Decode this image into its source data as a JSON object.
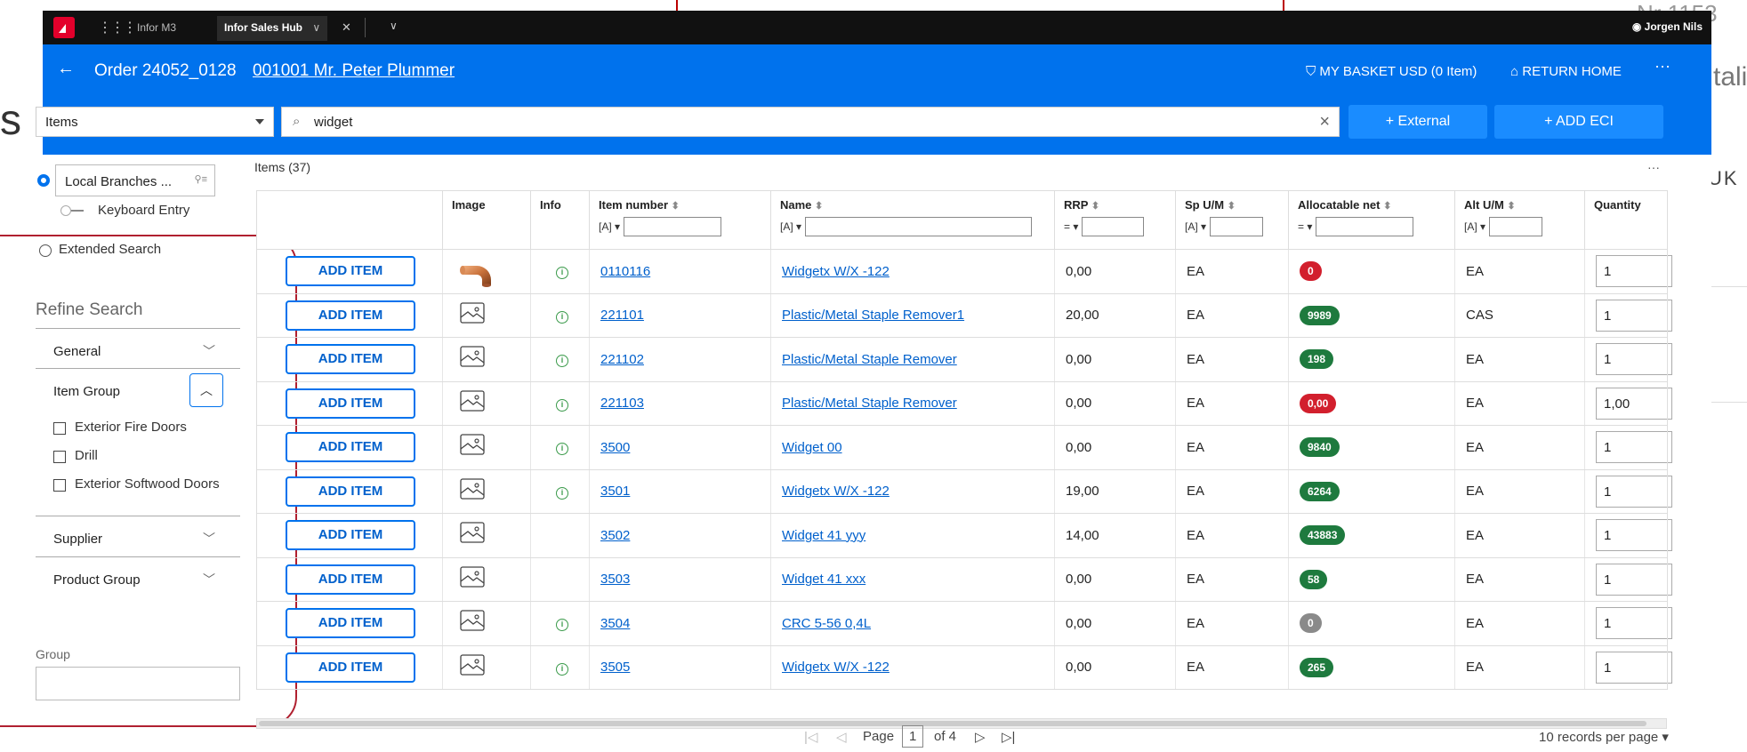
{
  "background": {
    "left_letter": "s",
    "right_nr": "Nr 1153",
    "right_tali": "tali",
    "right_uk": "UK"
  },
  "topbar": {
    "tab1": "Infor M3",
    "tab2": "Infor Sales Hub",
    "tab2_chevron": "∨",
    "tab2_close": "✕",
    "more": "∨",
    "user": "Jorgen Nils"
  },
  "header": {
    "back": "←",
    "order_title": "Order 24052_0128",
    "customer_link": "001001 Mr. Peter Plummer",
    "basket": "MY BASKET USD (0 Item)",
    "return_home": "RETURN HOME",
    "more": "···"
  },
  "search": {
    "category": "Items",
    "query": "widget",
    "external_button": "+ External",
    "add_eci_button": "+ ADD ECI"
  },
  "left_panel": {
    "local_branches": "Local Branches ...",
    "keyboard_entry": "Keyboard Entry",
    "extended_search": "Extended Search",
    "refine_title": "Refine Search",
    "facets": {
      "general": "General",
      "item_group": "Item Group",
      "supplier": "Supplier",
      "product_group": "Product Group"
    },
    "item_group_options": [
      "Exterior Fire Doors",
      "Drill",
      "Exterior Softwood Doors"
    ],
    "group_label": "Group"
  },
  "table": {
    "count_label": "Items (37)",
    "more": "···",
    "headers": {
      "image": "Image",
      "info": "Info",
      "item_number": "Item number",
      "name": "Name",
      "rrp": "RRP",
      "sp_um": "Sp U/M",
      "allocatable": "Allocatable net",
      "alt_um": "Alt U/M",
      "quantity": "Quantity"
    },
    "filter_text_op": "[A] ▾",
    "filter_num_op": "= ▾",
    "add_label": "ADD ITEM",
    "rows": [
      {
        "item": "0110116",
        "name": "Widgetx W/X -122",
        "rrp": "0,00",
        "sp": "EA",
        "alloc": "0",
        "alloc_color": "red",
        "alt": "EA",
        "qty": "1",
        "info": true,
        "image": "photo"
      },
      {
        "item": "221101",
        "name": "Plastic/Metal Staple Remover1",
        "rrp": "20,00",
        "sp": "EA",
        "alloc": "9989",
        "alloc_color": "green",
        "alt": "CAS",
        "qty": "1",
        "info": true,
        "image": "placeholder"
      },
      {
        "item": "221102",
        "name": "Plastic/Metal Staple Remover",
        "rrp": "0,00",
        "sp": "EA",
        "alloc": "198",
        "alloc_color": "green",
        "alt": "EA",
        "qty": "1",
        "info": true,
        "image": "placeholder"
      },
      {
        "item": "221103",
        "name": "Plastic/Metal Staple Remover",
        "rrp": "0,00",
        "sp": "EA",
        "alloc": "0,00",
        "alloc_color": "red",
        "alt": "EA",
        "qty": "1,00",
        "info": true,
        "image": "placeholder"
      },
      {
        "item": "3500",
        "name": "Widget 00",
        "rrp": "0,00",
        "sp": "EA",
        "alloc": "9840",
        "alloc_color": "green",
        "alt": "EA",
        "qty": "1",
        "info": true,
        "image": "placeholder"
      },
      {
        "item": "3501",
        "name": "Widgetx W/X -122",
        "rrp": "19,00",
        "sp": "EA",
        "alloc": "6264",
        "alloc_color": "green",
        "alt": "EA",
        "qty": "1",
        "info": true,
        "image": "placeholder"
      },
      {
        "item": "3502",
        "name": "Widget 41 yyy",
        "rrp": "14,00",
        "sp": "EA",
        "alloc": "43883",
        "alloc_color": "green",
        "alt": "EA",
        "qty": "1",
        "info": false,
        "image": "placeholder"
      },
      {
        "item": "3503",
        "name": "Widget 41 xxx",
        "rrp": "0,00",
        "sp": "EA",
        "alloc": "58",
        "alloc_color": "green",
        "alt": "EA",
        "qty": "1",
        "info": false,
        "image": "placeholder"
      },
      {
        "item": "3504",
        "name": "CRC 5-56 0,4L",
        "rrp": "0,00",
        "sp": "EA",
        "alloc": "0",
        "alloc_color": "grey",
        "alt": "EA",
        "qty": "1",
        "info": true,
        "image": "placeholder"
      },
      {
        "item": "3505",
        "name": "Widgetx W/X -122",
        "rrp": "0,00",
        "sp": "EA",
        "alloc": "265",
        "alloc_color": "green",
        "alt": "EA",
        "qty": "1",
        "info": true,
        "image": "placeholder"
      }
    ]
  },
  "pager": {
    "first": "|◁",
    "prev": "◁",
    "page_label": "Page",
    "page": "1",
    "of": "of 4",
    "next": "▷",
    "last": "▷|",
    "records": "10 records per page ▾"
  },
  "colors": {
    "brand_blue": "#0072ed",
    "badge_red": "#d21f2d",
    "badge_green": "#1e7a3e",
    "badge_grey": "#8a8a8a",
    "annotation_red": "#b02030"
  }
}
